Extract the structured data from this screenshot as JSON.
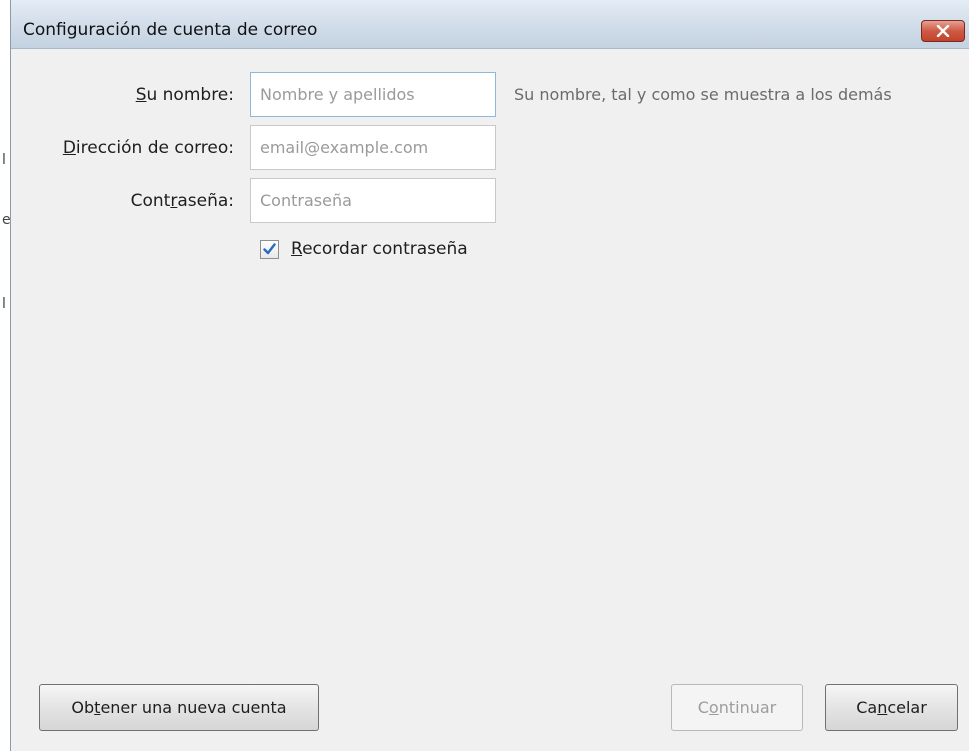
{
  "window": {
    "title": "Configuración de cuenta de correo"
  },
  "form": {
    "name": {
      "label_accesskey": "S",
      "label_rest": "u nombre:",
      "value": "",
      "placeholder": "Nombre y apellidos",
      "hint": "Su nombre, tal y como se muestra a los demás"
    },
    "email": {
      "label_accesskey": "D",
      "label_rest": "irección de correo:",
      "value": "",
      "placeholder": "email@example.com"
    },
    "password": {
      "label_pre": "Cont",
      "label_accesskey": "r",
      "label_post": "aseña:",
      "value": "",
      "placeholder": "Contraseña"
    },
    "remember": {
      "checked": true,
      "label_accesskey": "R",
      "label_rest": "ecordar contraseña"
    }
  },
  "buttons": {
    "new_account": {
      "pre": "Ob",
      "accesskey": "t",
      "post": "ener una nueva cuenta"
    },
    "continue": {
      "pre": "C",
      "accesskey": "o",
      "post": "ntinuar",
      "disabled": true
    },
    "cancel": {
      "pre": "Ca",
      "accesskey": "n",
      "post": "celar"
    }
  },
  "icons": {
    "close": "close-icon",
    "checkmark": "checkmark-icon"
  },
  "colors": {
    "dialog_bg": "#f0f0f0",
    "titlebar": "#cfdbe8",
    "close_button": "#c3432c",
    "hint_text": "#6b6b6b",
    "checkmark": "#2a6bbd"
  }
}
